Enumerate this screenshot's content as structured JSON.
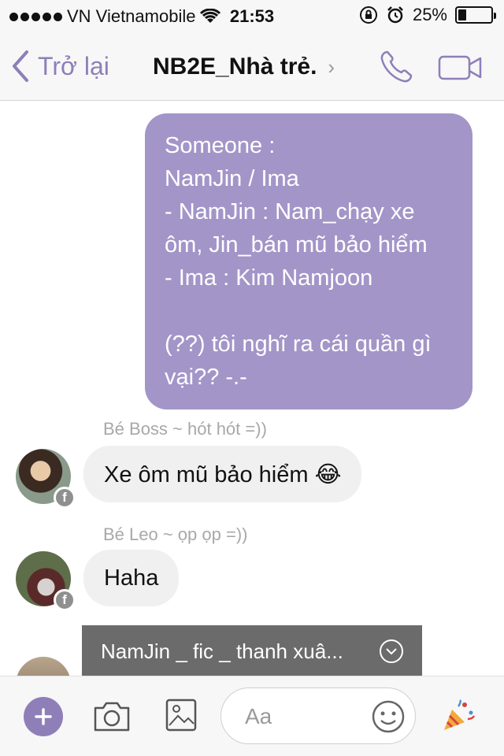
{
  "status_bar": {
    "carrier": "VN Vietnamobile",
    "time": "21:53",
    "battery_text": "25%",
    "battery_level": 0.25
  },
  "nav": {
    "back_label": "Trở lại",
    "title": "NB2E_Nhà trẻ.",
    "title_chevron": "›"
  },
  "messages": {
    "outgoing_text": "Someone :\nNamJin / Ima\n- NamJin : Nam_chạy xe ôm, Jin_bán mũ bảo hiểm\n- Ima : Kim Namjoon\n\n(??) tôi nghĩ ra cái quần gì vại?? -.-",
    "incoming": [
      {
        "sender": "Bé Boss ~ hót hót =))",
        "text": "Xe ôm mũ bảo hiểm 😂",
        "badge": "f"
      },
      {
        "sender": "Bé Leo ~ ọp ọp =))",
        "text": "Haha",
        "badge": "f"
      }
    ],
    "attachment_label": "NamJin _ fic _ thanh xuâ..."
  },
  "composer": {
    "placeholder": "Aa"
  },
  "colors": {
    "accent": "#8f7fb8",
    "outgoing_bubble": "#a395c8",
    "incoming_bubble": "#f0f0f0"
  },
  "icons": [
    "signal-dots-icon",
    "wifi-icon",
    "orientation-lock-icon",
    "alarm-icon",
    "battery-icon",
    "back-chevron-icon",
    "phone-icon",
    "video-icon",
    "plus-icon",
    "camera-icon",
    "gallery-icon",
    "emoji-icon",
    "party-popper-icon",
    "chevron-down-circle-icon"
  ]
}
